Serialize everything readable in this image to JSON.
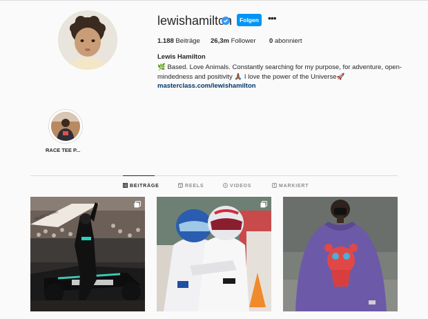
{
  "profile": {
    "username": "lewishamilton",
    "follow_label": "Folgen",
    "more_label": "•••",
    "stats": {
      "posts": "1.188",
      "posts_label": "Beiträge",
      "followers": "26,3m",
      "followers_label": "Follower",
      "following": "0",
      "following_label": "abonniert"
    },
    "full_name": "Lewis Hamilton",
    "bio_line1": "🌿 Based. Love Animals. Constantly searching for my purpose, for adventure, open-",
    "bio_line2": "mindedness and positivity 🙏🏾 I love the power of the Universe🚀",
    "link": "masterclass.com/lewishamilton"
  },
  "highlights": [
    {
      "label": "RACE TEE P..."
    }
  ],
  "tabs": [
    {
      "label": "BEITRÄGE",
      "icon": "grid-icon",
      "active": true
    },
    {
      "label": "REELS",
      "icon": "reels-icon",
      "active": false
    },
    {
      "label": "VIDEOS",
      "icon": "video-icon",
      "active": false
    },
    {
      "label": "MARKIERT",
      "icon": "tagged-icon",
      "active": false
    }
  ],
  "posts": [
    {
      "subject": "race-car-celebration",
      "multi": true
    },
    {
      "subject": "teammates-hug",
      "multi": true
    },
    {
      "subject": "purple-sweater-portrait",
      "multi": false
    }
  ],
  "colors": {
    "accent": "#0095f6",
    "link": "#00376b",
    "text": "#262626",
    "muted": "#8e8e8e",
    "border": "#dbdbdb"
  }
}
